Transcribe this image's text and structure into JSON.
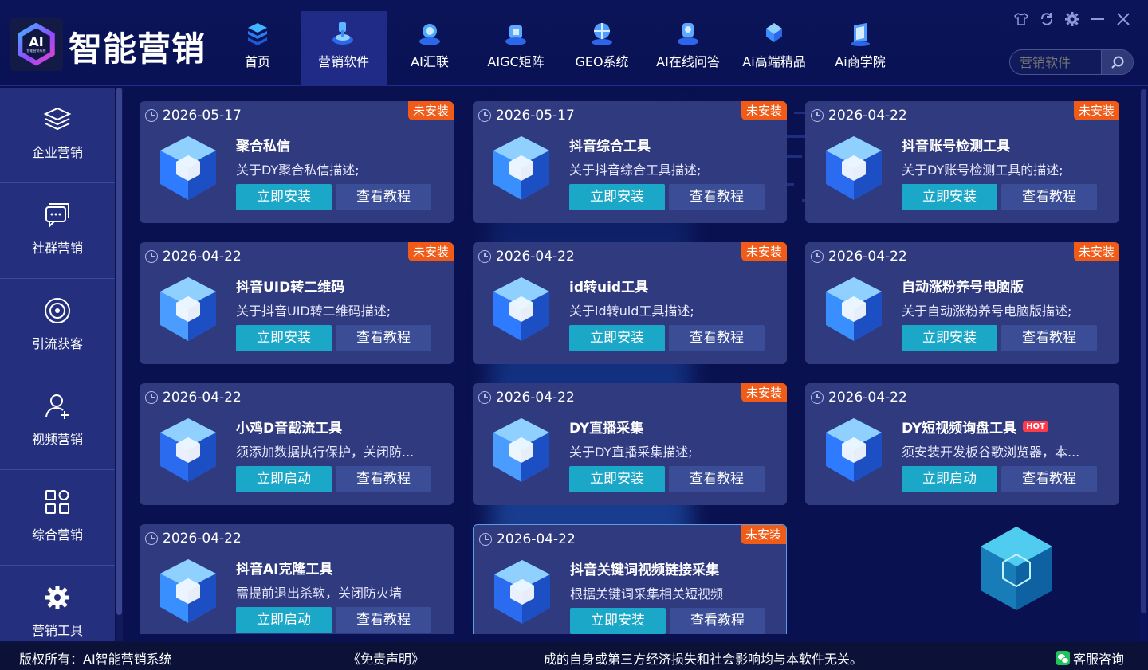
{
  "brand": {
    "logo_text": "AI",
    "logo_subtext": "智能营销系统",
    "name": "智能营销"
  },
  "nav": [
    {
      "label": "首页",
      "icon": "home-icon"
    },
    {
      "label": "营销软件",
      "icon": "software-icon",
      "active": true
    },
    {
      "label": "AI汇联",
      "icon": "ai-link-icon"
    },
    {
      "label": "AIGC矩阵",
      "icon": "aigc-matrix-icon"
    },
    {
      "label": "GEO系统",
      "icon": "geo-icon"
    },
    {
      "label": "AI在线问答",
      "icon": "qa-icon"
    },
    {
      "label": "Ai高端精品",
      "icon": "premium-icon"
    },
    {
      "label": "Ai商学院",
      "icon": "academy-icon"
    }
  ],
  "search": {
    "placeholder": "营销软件"
  },
  "sidebar": [
    {
      "label": "企业营销",
      "icon": "layers-icon"
    },
    {
      "label": "社群营销",
      "icon": "chat-icon"
    },
    {
      "label": "引流获客",
      "icon": "target-icon"
    },
    {
      "label": "视频营销",
      "icon": "user-add-icon"
    },
    {
      "label": "综合营销",
      "icon": "grid-icon"
    },
    {
      "label": "营销工具",
      "icon": "gear-icon"
    }
  ],
  "cards": [
    {
      "date": "2026-05-17",
      "badge": "未安装",
      "title": "聚合私信",
      "desc": "关于DY聚合私信描述;",
      "primary": "立即安装",
      "secondary": "查看教程"
    },
    {
      "date": "2026-05-17",
      "badge": "未安装",
      "title": "抖音综合工具",
      "desc": "关于抖音综合工具描述;",
      "primary": "立即安装",
      "secondary": "查看教程"
    },
    {
      "date": "2026-04-22",
      "badge": "未安装",
      "title": "抖音账号检测工具",
      "desc": "关于DY账号检测工具的描述;",
      "primary": "立即安装",
      "secondary": "查看教程"
    },
    {
      "date": "2026-04-22",
      "badge": "未安装",
      "title": "抖音UID转二维码",
      "desc": "关于抖音UID转二维码描述;",
      "primary": "立即安装",
      "secondary": "查看教程"
    },
    {
      "date": "2026-04-22",
      "badge": "未安装",
      "title": "id转uid工具",
      "desc": "关于id转uid工具描述;",
      "primary": "立即安装",
      "secondary": "查看教程"
    },
    {
      "date": "2026-04-22",
      "badge": "未安装",
      "title": "自动涨粉养号电脑版",
      "desc": "关于自动涨粉养号电脑版描述;",
      "primary": "立即安装",
      "secondary": "查看教程"
    },
    {
      "date": "2026-04-22",
      "badge": "",
      "title": "小鸡D音截流工具",
      "desc": "须添加数据执行保护，关闭防...",
      "primary": "立即启动",
      "secondary": "查看教程"
    },
    {
      "date": "2026-04-22",
      "badge": "未安装",
      "title": "DY直播采集",
      "desc": "关于DY直播采集描述;",
      "primary": "立即安装",
      "secondary": "查看教程"
    },
    {
      "date": "2026-04-22",
      "badge": "",
      "title": "DY短视频询盘工具",
      "hot": "HOT",
      "desc": "须安装开发板谷歌浏览器，本...",
      "primary": "立即启动",
      "secondary": "查看教程"
    },
    {
      "date": "2026-04-22",
      "badge": "",
      "title": "抖音AI克隆工具",
      "desc": "需提前退出杀软，关闭防火墙",
      "primary": "立即启动",
      "secondary": "查看教程"
    },
    {
      "date": "2026-04-22",
      "badge": "未安装",
      "title": "抖音关键词视频链接采集",
      "desc": "根据关键词采集相关短视频",
      "primary": "立即安装",
      "secondary": "查看教程"
    }
  ],
  "footer": {
    "copyright": "版权所有：AI智能营销系统",
    "disclaimer": "《免责声明》",
    "notice": "成的自身或第三方经济损失和社会影响均与本软件无关。",
    "service": "客服咨询"
  },
  "colors": {
    "accent": "#1aa7c8",
    "badge": "#f05b17",
    "card": "#303a7e",
    "background": "#0a1150"
  }
}
